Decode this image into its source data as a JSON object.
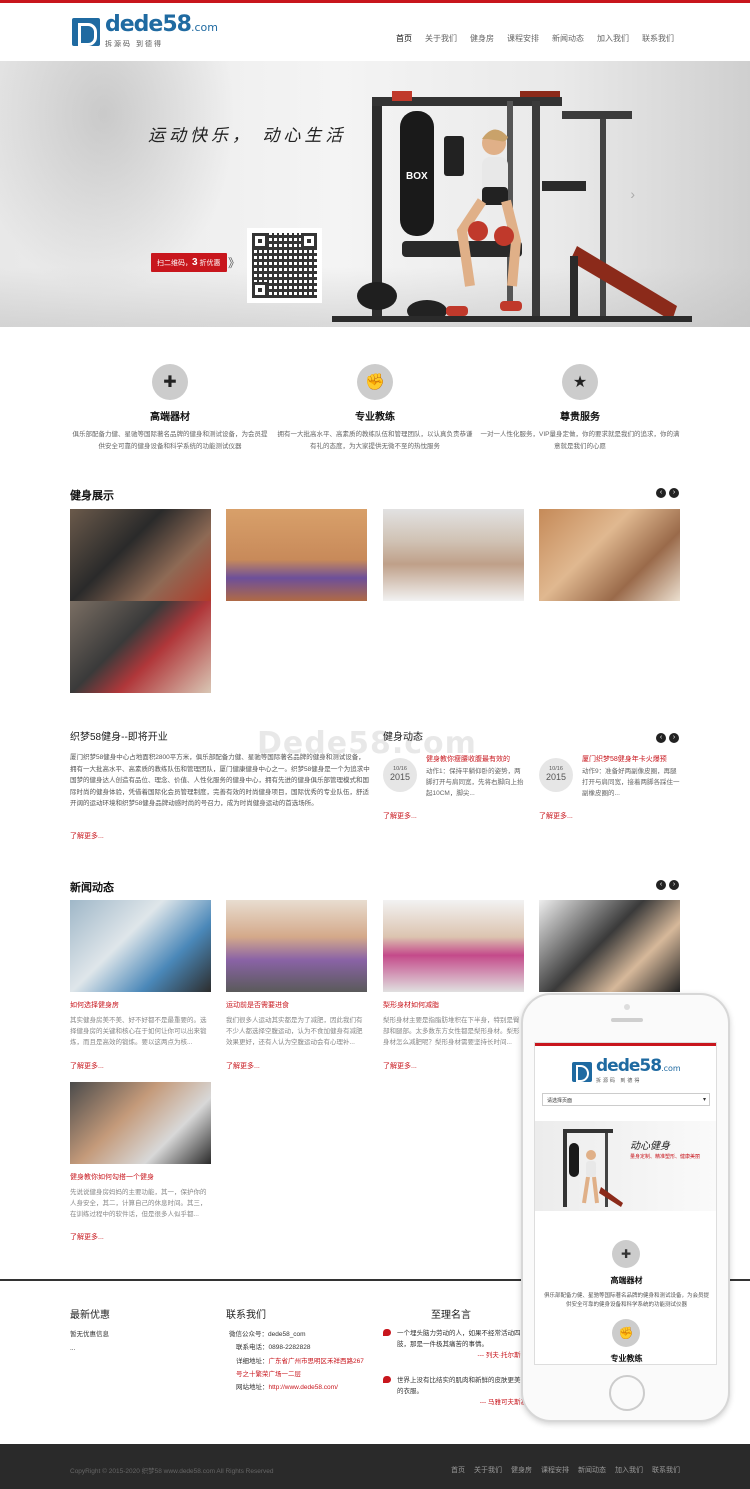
{
  "brand": {
    "logo_word": "dede58",
    "logo_tld": ".com",
    "slogan": "拆源码 到德得",
    "accent_color": "#c8161d",
    "logo_color": "#1f6aa1"
  },
  "nav": {
    "items": [
      "首页",
      "关于我们",
      "健身房",
      "课程安排",
      "新闻动态",
      "加入我们",
      "联系我们"
    ]
  },
  "banner": {
    "slogan": "运动快乐， 动心生活",
    "scan_prefix": "扫二维码，",
    "scan_number": "3",
    "scan_suffix": "折优惠",
    "arrow": "》",
    "next_icon": "chevron-right-icon"
  },
  "features": [
    {
      "icon": "dumbbell-icon",
      "glyph": "✚",
      "title": "高端器材",
      "desc": "俱乐部配备力健、星驰等国际著名品牌的健身和测试设备，为会员提供安全可靠的健身设备和科学系统的功能测试仪器"
    },
    {
      "icon": "arm-icon",
      "glyph": "✊",
      "title": "专业教练",
      "desc": "拥有一大批高水平、高素质的教练队伍和管理团队，以认真负责恭谦有礼的态度，为大家提供无微不至的热忱服务"
    },
    {
      "icon": "star-icon",
      "glyph": "★",
      "title": "尊贵服务",
      "desc": "一对一人性化服务，VIP量身定做，你的要求就是我们的追求，你的满意就是我们的心愿"
    }
  ],
  "showcase": {
    "title": "健身展示"
  },
  "about": {
    "title": "织梦58健身--即将开业",
    "text": "厦门织梦58健身中心占地面积2800平方米，俱乐部配备力健、星驰等国际著名品牌的健身和测试设备，拥有一大批高水平、高素质的教练队伍和管理团队，厦门健康健身中心之一。织梦58健身是一个为追求中国梦的健身达人创造有品位、理念、价值、人性化服务的健身中心，拥有先进的健身俱乐部管理模式和国际时尚的健身体验，凭借着国际化会员管理制度，完善有效的时尚健身项目，国际优秀的专业队伍，舒适开阔的运动环境和织梦58健身品牌动感时尚的号召力，成为时尚健身运动的首选场所。",
    "more": "了解更多..."
  },
  "watermark": "Dede58.com",
  "dynamics": {
    "title": "健身动态",
    "items": [
      {
        "md": "10/16",
        "year": "2015",
        "title": "健身教你瘦腰收腹最有效的",
        "body": "动作1：保持平躺仰卧的姿势，两脚打开与肩同宽，先将右脚向上抬起10CM，脚尖...",
        "more": "了解更多..."
      },
      {
        "md": "10/16",
        "year": "2015",
        "title": "厦门织梦58健身年卡火爆预",
        "body": "动作9：准备好两副像皮圈，再腿打开与肩同宽，接着两脚各踩住一副橡皮圈的...",
        "more": "了解更多..."
      }
    ]
  },
  "news": {
    "title": "新闻动态",
    "items": [
      {
        "title": "如何选择健身房",
        "desc": "其实健身房美不美、好不好都不是最重要的。选择健身房的关键和核心在于如何让你可以出来锻炼，而且是高效的锻炼。要以这两点为核...",
        "more": "了解更多..."
      },
      {
        "title": "运动前是否需要进食",
        "desc": "我们很多人运动其实都是为了减肥，因此我们有不少人都选择空腹运动，认为不食加健身有减肥效果更好，还有人认为空腹运动会有心理补...",
        "more": "了解更多..."
      },
      {
        "title": "梨形身材如何减脂",
        "desc": "梨形身材主要是指脂肪堆积在下半身，特别是臀部和腿部。太多数东方女性都是梨形身材。梨形身材怎么减肥呢？梨形身材需要坚持长时间...",
        "more": "了解更多..."
      },
      {
        "title": "健身教你如何勾搭一个健身",
        "desc": "先说说健身房妈妈的主要功能，其一，保护你的人身安全，其二，计算自己的休息时间。其三，在训练过程中的软件话，但是很多人似乎都...",
        "more": "了解更多..."
      }
    ]
  },
  "footer": {
    "offers_title": "最新优惠",
    "offers_items": [
      "暂无优惠信息",
      "..."
    ],
    "contact_title": "联系我们",
    "contact": [
      {
        "label": "微信公众号：",
        "value": "dede58_com"
      },
      {
        "label": "联系电话：",
        "value": "0898-2282828"
      },
      {
        "label": "详细地址：",
        "value": "广东省广州市思明区禾祥西路267号之十繁荣广场一二层"
      },
      {
        "label": "网站地址：",
        "value": "http://www.dede58.com/"
      }
    ],
    "quotes_title": "至理名言",
    "quotes": [
      {
        "text": "一个埋头脑力劳动的人，如果不经常活动四肢，那是一件极其痛苦的事情。",
        "src": "--- 列夫·托尔斯泰"
      },
      {
        "text": "世界上没有比结实的肌肉和新鲜的皮肤更美丽的衣服。",
        "src": "--- 马雅可夫斯基"
      }
    ]
  },
  "bottom": {
    "copyright": "CopyRight © 2015-2020 织梦58 www.dede58.com All Rights Reserved",
    "nav": [
      "首页",
      "关于我们",
      "健身房",
      "课程安排",
      "新闻动态",
      "加入我们",
      "联系我们"
    ]
  },
  "mobile": {
    "select_value": "请选择页面",
    "banner_title": "动心健身",
    "banner_sub": "量身定制、精准塑形、健康美丽",
    "features": [
      {
        "icon": "dumbbell-icon",
        "glyph": "✚",
        "title": "高端器材",
        "desc": "俱乐部配备力健、星驰等国际著名品牌的健身和测试设备，为会员提供安全可靠的健身设备和科学系统的功能测试仪器"
      },
      {
        "icon": "arm-icon",
        "glyph": "✊",
        "title": "专业教练"
      }
    ]
  }
}
